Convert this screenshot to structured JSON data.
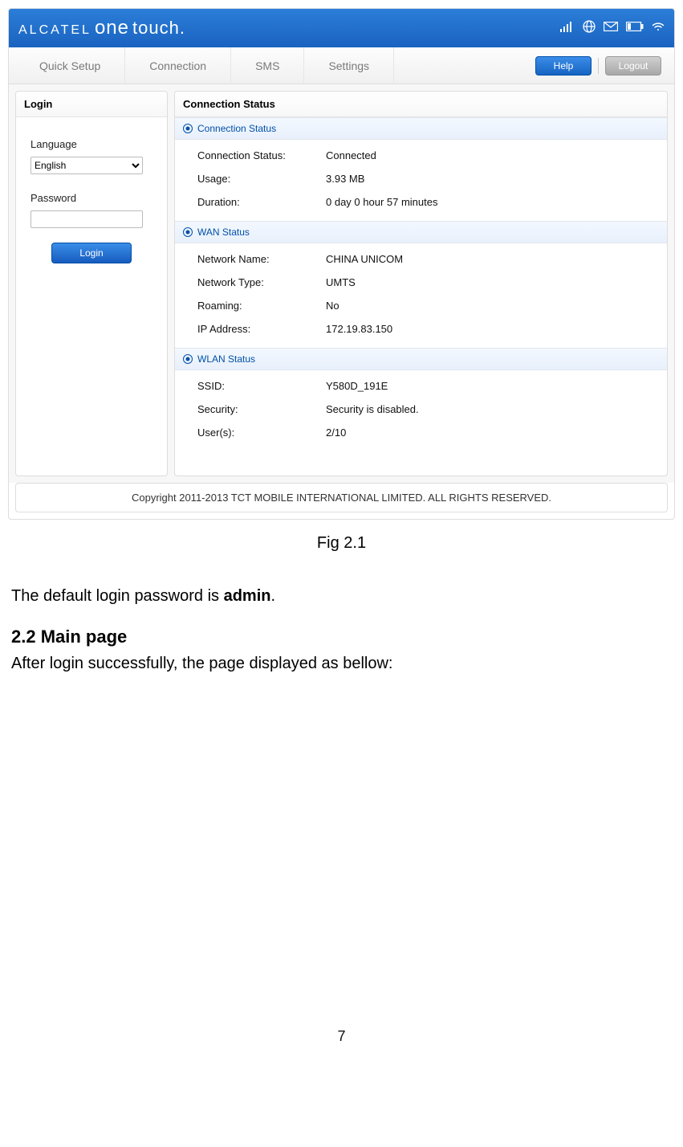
{
  "brand": {
    "alcatel": "ALCATEL",
    "one": "one",
    "touch": "touch."
  },
  "nav": {
    "tabs": [
      "Quick Setup",
      "Connection",
      "SMS",
      "Settings"
    ],
    "help": "Help",
    "logout": "Logout"
  },
  "login": {
    "title": "Login",
    "language_label": "Language",
    "language_value": "English",
    "password_label": "Password",
    "login_btn": "Login"
  },
  "status": {
    "panel_title": "Connection Status",
    "section_connection": "Connection Status",
    "connection": {
      "status_k": "Connection Status:",
      "status_v": "Connected",
      "usage_k": "Usage:",
      "usage_v": "3.93 MB",
      "duration_k": "Duration:",
      "duration_v": "0 day 0 hour 57 minutes"
    },
    "section_wan": "WAN Status",
    "wan": {
      "name_k": "Network Name:",
      "name_v": "CHINA UNICOM",
      "type_k": "Network Type:",
      "type_v": "UMTS",
      "roaming_k": "Roaming:",
      "roaming_v": "No",
      "ip_k": "IP Address:",
      "ip_v": "172.19.83.150"
    },
    "section_wlan": "WLAN Status",
    "wlan": {
      "ssid_k": "SSID:",
      "ssid_v": "Y580D_191E",
      "security_k": "Security:",
      "security_v": "Security is disabled.",
      "users_k": "User(s):",
      "users_v": "2/10"
    }
  },
  "footer": "Copyright 2011-2013 TCT MOBILE INTERNATIONAL LIMITED. ALL RIGHTS RESERVED.",
  "caption": "Fig 2.1",
  "doc": {
    "line1_pre": "The default login password is ",
    "line1_bold": "admin",
    "line1_post": ".",
    "heading": "2.2 Main page",
    "line2": "After login successfully, the page displayed as bellow:"
  },
  "page_number": "7"
}
